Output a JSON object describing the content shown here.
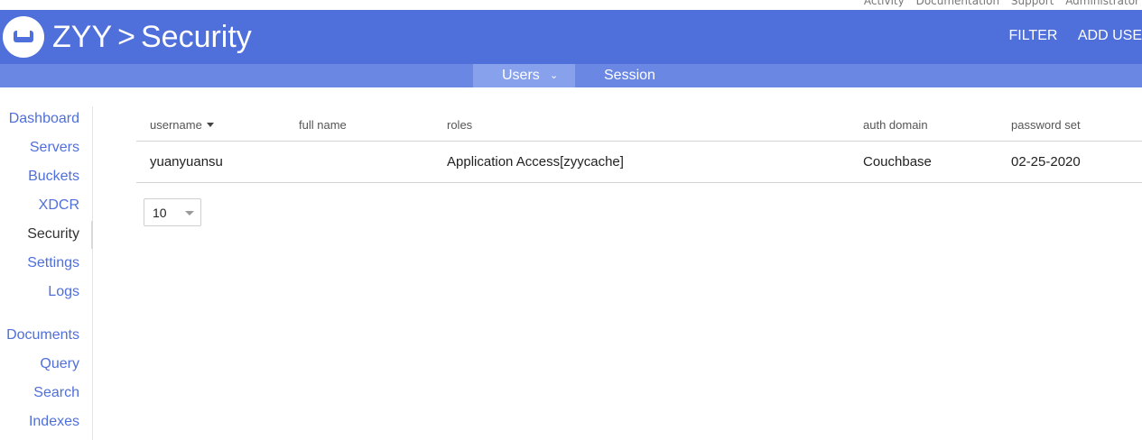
{
  "top_links": [
    "Activity",
    "Documentation",
    "Support",
    "Administrator"
  ],
  "header": {
    "cluster": "ZYY",
    "separator": ">",
    "section": "Security",
    "actions": {
      "filter": "FILTER",
      "add_user": "ADD USE"
    }
  },
  "subnav": {
    "users": "Users",
    "session": "Session"
  },
  "sidebar": {
    "items": [
      "Dashboard",
      "Servers",
      "Buckets",
      "XDCR",
      "Security",
      "Settings",
      "Logs",
      "Documents",
      "Query",
      "Search",
      "Indexes"
    ],
    "current": "Security"
  },
  "table": {
    "columns": [
      "username",
      "full name",
      "roles",
      "auth domain",
      "password set"
    ],
    "sorted_by": "username",
    "rows": [
      {
        "username": "yuanyuansu",
        "full_name": "",
        "roles": "Application Access[zyycache]",
        "auth_domain": "Couchbase",
        "password_set": "02-25-2020"
      }
    ]
  },
  "pager": {
    "page_size": "10"
  },
  "colors": {
    "brand": "#4f6fdb",
    "subnav": "#6a87e3",
    "subnav_active": "#87a1ec",
    "link": "#4f6fdb"
  },
  "icons": {
    "logo": "couchbase-logo-icon",
    "sort": "caret-down-icon",
    "dropdown": "chevron-down-icon"
  }
}
